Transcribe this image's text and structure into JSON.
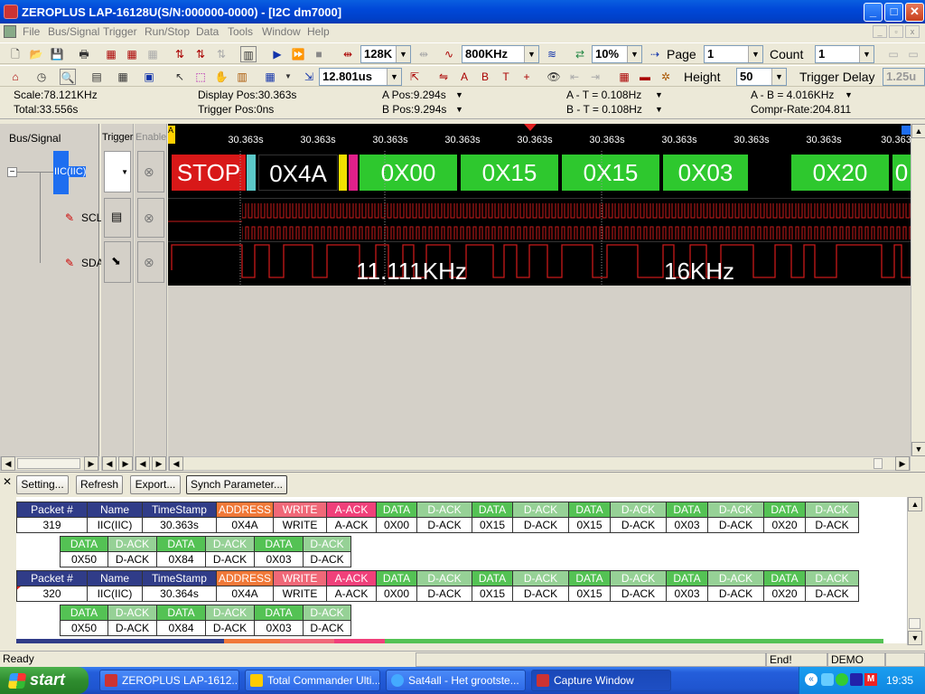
{
  "window": {
    "title": "ZEROPLUS LAP-16128U(S/N:000000-0000) - [I2C dm7000]",
    "min": "_",
    "max": "□",
    "close": "✕"
  },
  "menu": [
    "File",
    "Bus/Signal",
    "Trigger",
    "Run/Stop",
    "Data",
    "Tools",
    "Window",
    "Help"
  ],
  "toolbar1": {
    "memory": "128K",
    "frequency": "800KHz",
    "trigger_pct": "10%",
    "page_label": "Page",
    "page_value": "1",
    "count_label": "Count",
    "count_value": "1"
  },
  "toolbar2": {
    "time": "12.801us",
    "height_label": "Height",
    "height_value": "50",
    "trigger_delay_label": "Trigger Delay",
    "trigger_delay_value": "1.25u"
  },
  "info": {
    "scale": "Scale:78.121KHz",
    "total": "Total:33.556s",
    "display_pos": "Display Pos:30.363s",
    "trigger_pos": "Trigger Pos:0ns",
    "a_pos": "A Pos:9.294s",
    "b_pos": "B Pos:9.294s",
    "a_t": "A - T = 0.108Hz",
    "b_t": "B - T = 0.108Hz",
    "a_b": "A - B = 4.016KHz",
    "compr": "Compr-Rate:204.811"
  },
  "signals": {
    "header": "Bus/Signal",
    "trigger_header": "Trigger",
    "enable_header": "Enable",
    "bus": "IIC(IIC)",
    "scl": "SCL",
    "sda": "SDA"
  },
  "ruler": {
    "ticks": [
      "30.363s",
      "30.363s",
      "30.363s",
      "30.363s",
      "30.363s",
      "30.363s",
      "30.363s",
      "30.363s",
      "30.363s",
      "30.363"
    ],
    "cursor_a": "A"
  },
  "wave_packets": [
    "STOP",
    "0X4A",
    "0X00",
    "0X15",
    "0X15",
    "0X03",
    "0X20",
    "0"
  ],
  "measure": {
    "f1": "11.111KHz",
    "f2": "16KHz"
  },
  "buttons": {
    "setting": "Setting...",
    "refresh": "Refresh",
    "export": "Export...",
    "synch": "Synch Parameter..."
  },
  "table": {
    "headers_row1": [
      "Packet #",
      "Name",
      "TimeStamp",
      "ADDRESS",
      "WRITE",
      "A-ACK",
      "DATA",
      "D-ACK",
      "DATA",
      "D-ACK",
      "DATA",
      "D-ACK",
      "DATA",
      "D-ACK",
      "DATA",
      "D-ACK"
    ],
    "headers_row2": [
      "DATA",
      "D-ACK",
      "DATA",
      "D-ACK",
      "DATA",
      "D-ACK"
    ],
    "packets": [
      {
        "row1": [
          "319",
          "IIC(IIC)",
          "30.363s",
          "0X4A",
          "WRITE",
          "A-ACK",
          "0X00",
          "D-ACK",
          "0X15",
          "D-ACK",
          "0X15",
          "D-ACK",
          "0X03",
          "D-ACK",
          "0X20",
          "D-ACK"
        ],
        "row2": [
          "0X50",
          "D-ACK",
          "0X84",
          "D-ACK",
          "0X03",
          "D-ACK"
        ]
      },
      {
        "row1": [
          "320",
          "IIC(IIC)",
          "30.364s",
          "0X4A",
          "WRITE",
          "A-ACK",
          "0X00",
          "D-ACK",
          "0X15",
          "D-ACK",
          "0X15",
          "D-ACK",
          "0X03",
          "D-ACK",
          "0X20",
          "D-ACK"
        ],
        "row2": [
          "0X50",
          "D-ACK",
          "0X84",
          "D-ACK",
          "0X03",
          "D-ACK"
        ]
      }
    ]
  },
  "status": {
    "ready": "Ready",
    "end": "End!",
    "mode": "DEMO"
  },
  "taskbar": {
    "start": "start",
    "tasks": [
      "ZEROPLUS LAP-1612...",
      "Total Commander Ulti...",
      "Sat4all - Het grootste...",
      "Capture Window"
    ],
    "clock": "19:35"
  }
}
